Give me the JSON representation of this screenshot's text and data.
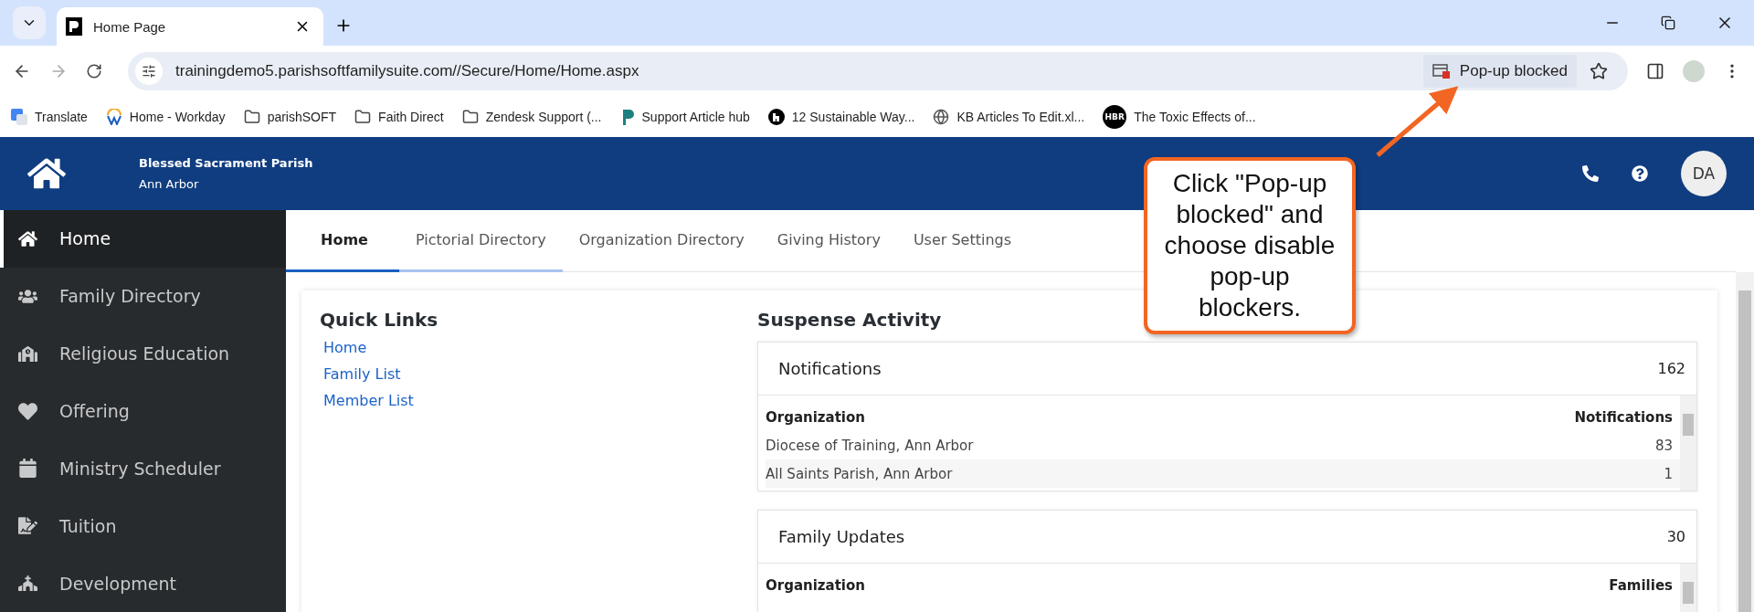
{
  "browser": {
    "tab_title": "Home Page",
    "url": "trainingdemo5.parishsoftfamilysuite.com//Secure/Home/Home.aspx",
    "popup_notice": "Pop-up blocked",
    "bookmarks": [
      {
        "kind": "translate",
        "label": "Translate"
      },
      {
        "kind": "workday",
        "label": "Home - Workday"
      },
      {
        "kind": "folder",
        "label": "parishSOFT"
      },
      {
        "kind": "folder",
        "label": "Faith Direct"
      },
      {
        "kind": "folder",
        "label": "Zendesk Support (..."
      },
      {
        "kind": "parish",
        "label": "Support Article hub"
      },
      {
        "kind": "circle",
        "label": "12 Sustainable Way..."
      },
      {
        "kind": "globe",
        "label": "KB Articles To Edit.xl..."
      },
      {
        "kind": "hbr",
        "badge": "HBR",
        "label": "The Toxic Effects of..."
      }
    ]
  },
  "header": {
    "parish": "Blessed Sacrament Parish",
    "city": "Ann Arbor",
    "avatar": "DA"
  },
  "sidebar": {
    "items": [
      {
        "label": "Home",
        "selected": true
      },
      {
        "label": "Family Directory",
        "selected": false
      },
      {
        "label": "Religious Education",
        "selected": false
      },
      {
        "label": "Offering",
        "selected": false
      },
      {
        "label": "Ministry Scheduler",
        "selected": false
      },
      {
        "label": "Tuition",
        "selected": false
      },
      {
        "label": "Development",
        "selected": false
      }
    ]
  },
  "tabs": [
    {
      "label": "Home",
      "selected": true,
      "hovered": false
    },
    {
      "label": "Pictorial Directory",
      "selected": false,
      "hovered": true
    },
    {
      "label": "Organization Directory",
      "selected": false,
      "hovered": false
    },
    {
      "label": "Giving History",
      "selected": false,
      "hovered": false
    },
    {
      "label": "User Settings",
      "selected": false,
      "hovered": false
    }
  ],
  "quick_links": {
    "title": "Quick Links",
    "links": [
      "Home",
      "Family List",
      "Member List"
    ]
  },
  "suspense": {
    "title": "Suspense Activity",
    "panels": [
      {
        "title": "Notifications",
        "count": "162",
        "columns": [
          "Organization",
          "Notifications"
        ],
        "rows": [
          [
            "Diocese of Training, Ann Arbor",
            "83"
          ],
          [
            "All Saints Parish, Ann Arbor",
            "1"
          ]
        ]
      },
      {
        "title": "Family Updates",
        "count": "30",
        "columns": [
          "Organization",
          "Families"
        ]
      }
    ]
  },
  "callout": {
    "text": "Click \"Pop-up blocked\" and choose disable pop-up blockers."
  }
}
